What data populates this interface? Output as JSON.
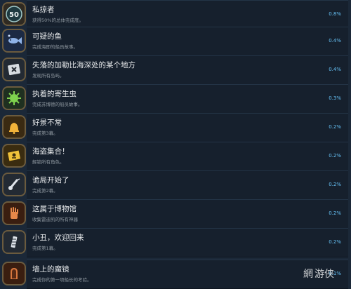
{
  "achievements": [
    {
      "title": "私掠者",
      "desc": "获得50%的总体完成度。",
      "percent": "0.8%",
      "icon": "fifty-badge-icon"
    },
    {
      "title": "可疑的鱼",
      "desc": "完成海即的船员故事。",
      "percent": "0.4%",
      "icon": "fish-icon"
    },
    {
      "title": "失落的加勒比海深处的某个地方",
      "desc": "发现所有岛屿。",
      "percent": "0.4%",
      "icon": "treasure-map-icon"
    },
    {
      "title": "执着的寄生虫",
      "desc": "完成苏博德的船员故事。",
      "percent": "0.3%",
      "icon": "parasite-icon"
    },
    {
      "title": "好景不常",
      "desc": "完成第3幕。",
      "percent": "0.2%",
      "icon": "bell-icon"
    },
    {
      "title": "海盗集合！",
      "desc": "解锁所有角色。",
      "percent": "0.2%",
      "icon": "pirate-flag-icon"
    },
    {
      "title": "诡局开始了",
      "desc": "完成第2幕。",
      "percent": "0.2%",
      "icon": "scroll-icon"
    },
    {
      "title": "这属于博物馆",
      "desc": "收集雷迪凯的所有神器",
      "percent": "0.2%",
      "icon": "hand-artifact-icon"
    },
    {
      "title": "小丑，欢迎回来",
      "desc": "完成第1幕。",
      "percent": "0.2%",
      "icon": "jester-icon"
    },
    {
      "title": "墙上的魔镜",
      "desc": "完成你的第一项船长的考验。",
      "percent": "0.1%",
      "icon": "mirror-icon"
    }
  ],
  "watermark": {
    "text": "游侠",
    "mark": "網"
  }
}
